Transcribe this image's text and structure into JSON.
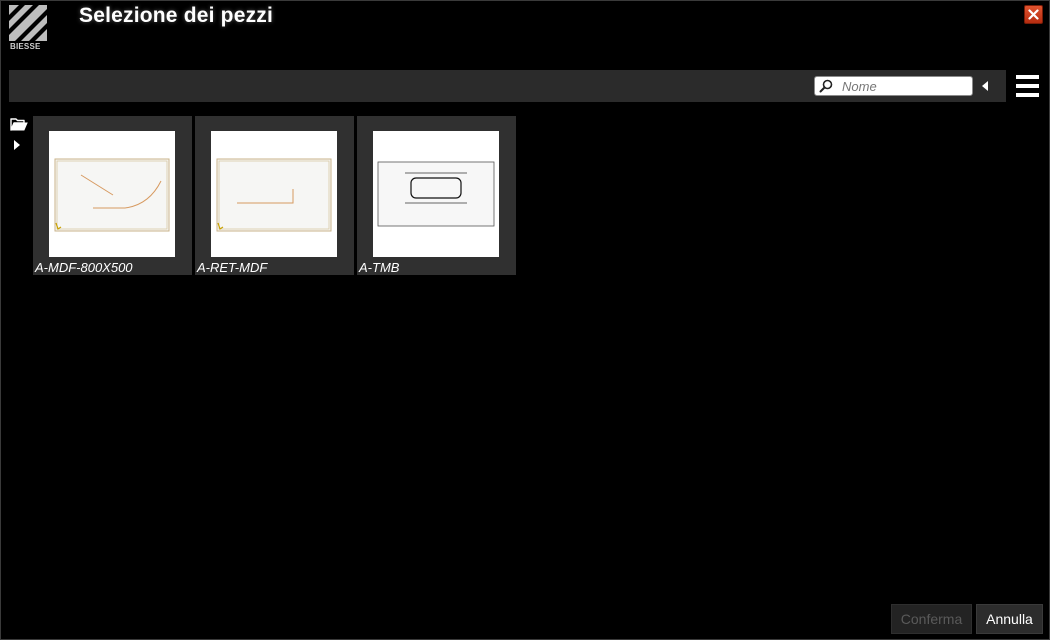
{
  "window": {
    "title": "Selezione dei pezzi",
    "logo_text": "BIESSE"
  },
  "toolbar": {
    "search_placeholder": "Nome"
  },
  "pieces": [
    {
      "name": "A-MDF-800X500"
    },
    {
      "name": "A-RET-MDF"
    },
    {
      "name": "A-TMB"
    }
  ],
  "footer": {
    "confirm_label": "Conferma",
    "cancel_label": "Annulla"
  },
  "icons": {
    "close": "close-icon",
    "search": "search-icon",
    "collapse": "triangle-left-icon",
    "menu": "hamburger-menu-icon",
    "folder": "open-folder-icon",
    "expand": "triangle-right-icon"
  },
  "colors": {
    "background": "#000000",
    "toolbar": "#2b2b2b",
    "tile": "#303030",
    "close_button": "#c8391a"
  }
}
